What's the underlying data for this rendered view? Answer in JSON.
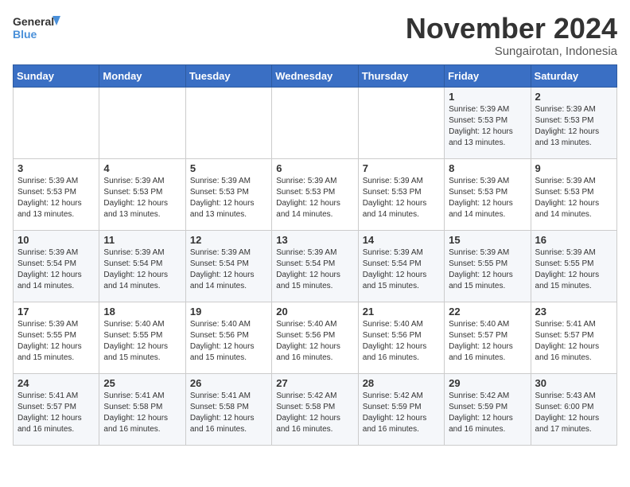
{
  "logo": {
    "line1": "General",
    "line2": "Blue"
  },
  "title": "November 2024",
  "subtitle": "Sungairotan, Indonesia",
  "days_of_week": [
    "Sunday",
    "Monday",
    "Tuesday",
    "Wednesday",
    "Thursday",
    "Friday",
    "Saturday"
  ],
  "weeks": [
    [
      {
        "day": "",
        "info": ""
      },
      {
        "day": "",
        "info": ""
      },
      {
        "day": "",
        "info": ""
      },
      {
        "day": "",
        "info": ""
      },
      {
        "day": "",
        "info": ""
      },
      {
        "day": "1",
        "info": "Sunrise: 5:39 AM\nSunset: 5:53 PM\nDaylight: 12 hours\nand 13 minutes."
      },
      {
        "day": "2",
        "info": "Sunrise: 5:39 AM\nSunset: 5:53 PM\nDaylight: 12 hours\nand 13 minutes."
      }
    ],
    [
      {
        "day": "3",
        "info": "Sunrise: 5:39 AM\nSunset: 5:53 PM\nDaylight: 12 hours\nand 13 minutes."
      },
      {
        "day": "4",
        "info": "Sunrise: 5:39 AM\nSunset: 5:53 PM\nDaylight: 12 hours\nand 13 minutes."
      },
      {
        "day": "5",
        "info": "Sunrise: 5:39 AM\nSunset: 5:53 PM\nDaylight: 12 hours\nand 13 minutes."
      },
      {
        "day": "6",
        "info": "Sunrise: 5:39 AM\nSunset: 5:53 PM\nDaylight: 12 hours\nand 14 minutes."
      },
      {
        "day": "7",
        "info": "Sunrise: 5:39 AM\nSunset: 5:53 PM\nDaylight: 12 hours\nand 14 minutes."
      },
      {
        "day": "8",
        "info": "Sunrise: 5:39 AM\nSunset: 5:53 PM\nDaylight: 12 hours\nand 14 minutes."
      },
      {
        "day": "9",
        "info": "Sunrise: 5:39 AM\nSunset: 5:53 PM\nDaylight: 12 hours\nand 14 minutes."
      }
    ],
    [
      {
        "day": "10",
        "info": "Sunrise: 5:39 AM\nSunset: 5:54 PM\nDaylight: 12 hours\nand 14 minutes."
      },
      {
        "day": "11",
        "info": "Sunrise: 5:39 AM\nSunset: 5:54 PM\nDaylight: 12 hours\nand 14 minutes."
      },
      {
        "day": "12",
        "info": "Sunrise: 5:39 AM\nSunset: 5:54 PM\nDaylight: 12 hours\nand 14 minutes."
      },
      {
        "day": "13",
        "info": "Sunrise: 5:39 AM\nSunset: 5:54 PM\nDaylight: 12 hours\nand 15 minutes."
      },
      {
        "day": "14",
        "info": "Sunrise: 5:39 AM\nSunset: 5:54 PM\nDaylight: 12 hours\nand 15 minutes."
      },
      {
        "day": "15",
        "info": "Sunrise: 5:39 AM\nSunset: 5:55 PM\nDaylight: 12 hours\nand 15 minutes."
      },
      {
        "day": "16",
        "info": "Sunrise: 5:39 AM\nSunset: 5:55 PM\nDaylight: 12 hours\nand 15 minutes."
      }
    ],
    [
      {
        "day": "17",
        "info": "Sunrise: 5:39 AM\nSunset: 5:55 PM\nDaylight: 12 hours\nand 15 minutes."
      },
      {
        "day": "18",
        "info": "Sunrise: 5:40 AM\nSunset: 5:55 PM\nDaylight: 12 hours\nand 15 minutes."
      },
      {
        "day": "19",
        "info": "Sunrise: 5:40 AM\nSunset: 5:56 PM\nDaylight: 12 hours\nand 15 minutes."
      },
      {
        "day": "20",
        "info": "Sunrise: 5:40 AM\nSunset: 5:56 PM\nDaylight: 12 hours\nand 16 minutes."
      },
      {
        "day": "21",
        "info": "Sunrise: 5:40 AM\nSunset: 5:56 PM\nDaylight: 12 hours\nand 16 minutes."
      },
      {
        "day": "22",
        "info": "Sunrise: 5:40 AM\nSunset: 5:57 PM\nDaylight: 12 hours\nand 16 minutes."
      },
      {
        "day": "23",
        "info": "Sunrise: 5:41 AM\nSunset: 5:57 PM\nDaylight: 12 hours\nand 16 minutes."
      }
    ],
    [
      {
        "day": "24",
        "info": "Sunrise: 5:41 AM\nSunset: 5:57 PM\nDaylight: 12 hours\nand 16 minutes."
      },
      {
        "day": "25",
        "info": "Sunrise: 5:41 AM\nSunset: 5:58 PM\nDaylight: 12 hours\nand 16 minutes."
      },
      {
        "day": "26",
        "info": "Sunrise: 5:41 AM\nSunset: 5:58 PM\nDaylight: 12 hours\nand 16 minutes."
      },
      {
        "day": "27",
        "info": "Sunrise: 5:42 AM\nSunset: 5:58 PM\nDaylight: 12 hours\nand 16 minutes."
      },
      {
        "day": "28",
        "info": "Sunrise: 5:42 AM\nSunset: 5:59 PM\nDaylight: 12 hours\nand 16 minutes."
      },
      {
        "day": "29",
        "info": "Sunrise: 5:42 AM\nSunset: 5:59 PM\nDaylight: 12 hours\nand 16 minutes."
      },
      {
        "day": "30",
        "info": "Sunrise: 5:43 AM\nSunset: 6:00 PM\nDaylight: 12 hours\nand 17 minutes."
      }
    ]
  ]
}
